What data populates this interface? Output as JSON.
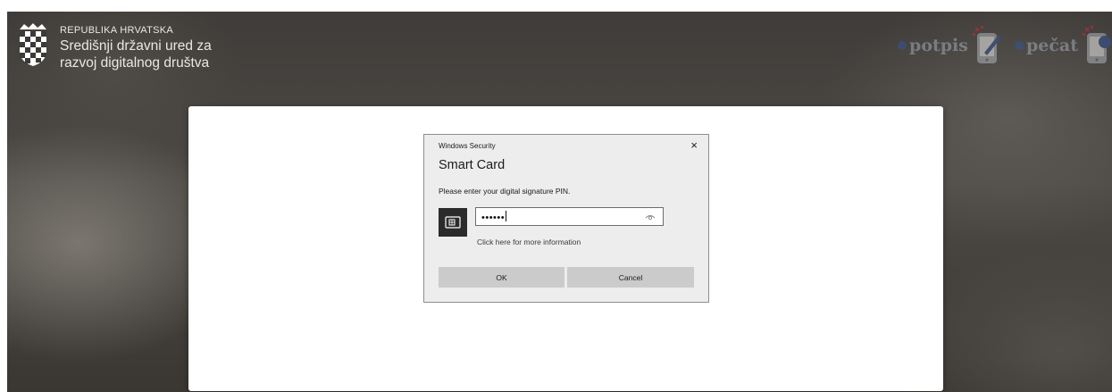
{
  "government": {
    "line1": "REPUBLIKA HRVATSKA",
    "line2": "Središnji državni ured za",
    "line3": "razvoj digitalnog društva"
  },
  "brands": [
    {
      "name": "potpis",
      "icon": "phone-pen-icon"
    },
    {
      "name": "pečat",
      "icon": "phone-seal-icon"
    }
  ],
  "dialog": {
    "header": "Windows Security",
    "close_label": "×",
    "title": "Smart Card",
    "message": "Please enter your digital signature PIN.",
    "pin_value": "••••••",
    "more_info": "Click here for more information",
    "ok_label": "OK",
    "cancel_label": "Cancel"
  },
  "colors": {
    "accent_blue": "#34559c",
    "accent_red": "#d8243a",
    "dialog_bg": "#ededed",
    "button_bg": "#cbcbcb"
  }
}
